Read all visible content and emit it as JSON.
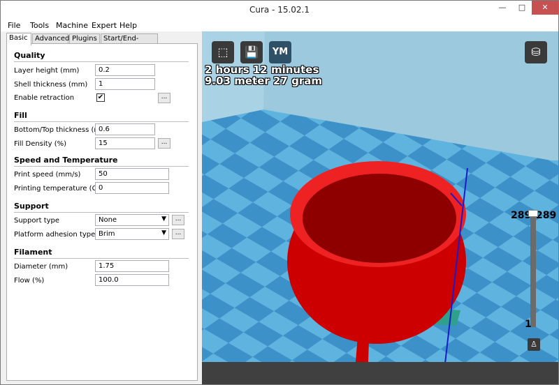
{
  "window": {
    "title": "Cura - 15.02.1",
    "min": "—",
    "max": "□",
    "close": "✕"
  },
  "menu": [
    "File",
    "Tools",
    "Machine",
    "Expert",
    "Help"
  ],
  "tabs": [
    "Basic",
    "Advanced",
    "Plugins",
    "Start/End-GCode"
  ],
  "quality": {
    "title": "Quality",
    "layer_height_label": "Layer height (mm)",
    "layer_height": "0.2",
    "shell_thickness_label": "Shell thickness (mm)",
    "shell_thickness": "1",
    "retraction_label": "Enable retraction",
    "retraction_checked": "✔"
  },
  "fill": {
    "title": "Fill",
    "bottom_top_label": "Bottom/Top thickness (mm)",
    "bottom_top": "0.6",
    "density_label": "Fill Density (%)",
    "density": "15"
  },
  "speed": {
    "title": "Speed and Temperature",
    "print_speed_label": "Print speed (mm/s)",
    "print_speed": "50",
    "temp_label": "Printing temperature (C)",
    "temp": "0"
  },
  "support": {
    "title": "Support",
    "type_label": "Support type",
    "type": "None",
    "adhesion_label": "Platform adhesion type",
    "adhesion": "Brim"
  },
  "filament": {
    "title": "Filament",
    "diameter_label": "Diameter (mm)",
    "diameter": "1.75",
    "flow_label": "Flow (%)",
    "flow": "100.0"
  },
  "dots_label": "...",
  "viewport": {
    "load_icon": "load-model-icon",
    "save_icon": "save-icon",
    "ym_label": "YM",
    "print_time": "2 hours 12 minutes",
    "material": "9.03 meter 27 gram",
    "layer_left": "289",
    "layer_right": "289",
    "layer_min": "1",
    "colors": {
      "sky": "#9cc9de",
      "bed_light": "#5fb3df",
      "bed_dark": "#3c92c8",
      "model": "#cc0000",
      "model_dark": "#8e0000"
    }
  }
}
